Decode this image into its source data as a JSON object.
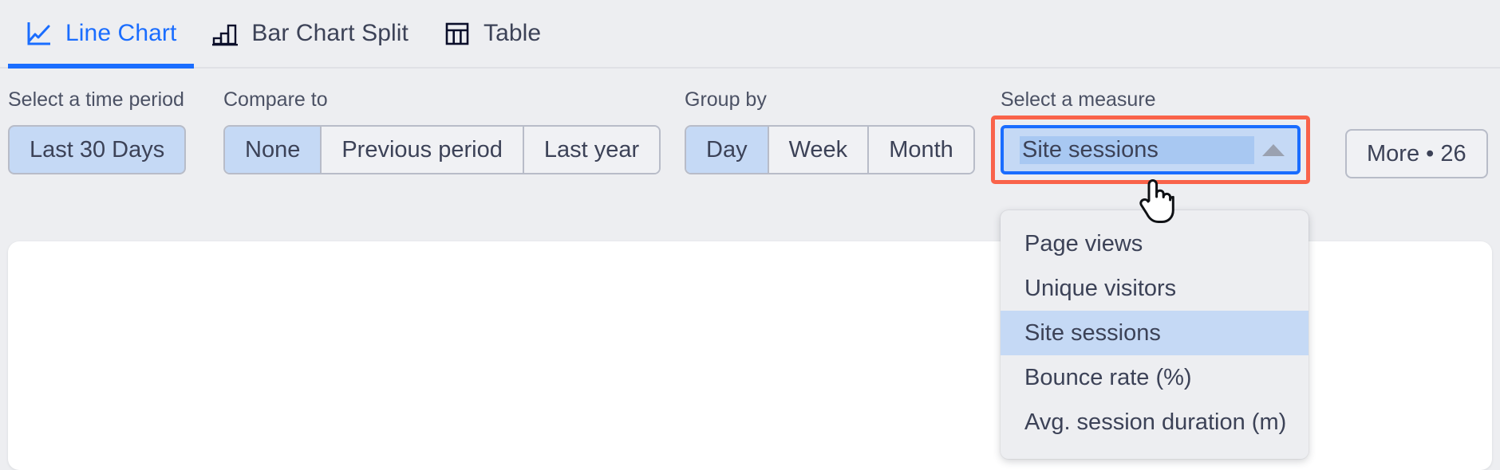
{
  "tabs": [
    {
      "label": "Line Chart",
      "icon": "line-chart-icon",
      "active": true
    },
    {
      "label": "Bar Chart Split",
      "icon": "bar-chart-icon",
      "active": false
    },
    {
      "label": "Table",
      "icon": "table-icon",
      "active": false
    }
  ],
  "filters": {
    "time_period": {
      "label": "Select a time period",
      "value": "Last 30 Days"
    },
    "compare_to": {
      "label": "Compare to",
      "options": [
        "None",
        "Previous period",
        "Last year"
      ],
      "selected": "None"
    },
    "group_by": {
      "label": "Group by",
      "options": [
        "Day",
        "Week",
        "Month"
      ],
      "selected": "Day"
    },
    "measure": {
      "label": "Select a measure",
      "value": "Site sessions",
      "expanded": true,
      "caret_icon": "caret-up-icon",
      "options": [
        "Page views",
        "Unique visitors",
        "Site sessions",
        "Bounce rate (%)",
        "Avg. session duration (m)"
      ],
      "selected_option": "Site sessions"
    },
    "more_button": {
      "label": "More • 26"
    }
  },
  "annotation": {
    "target": "measure-select",
    "color": "#f9634a"
  },
  "cursor": {
    "icon": "pointing-hand-cursor"
  },
  "colors": {
    "page_background": "#edeef1",
    "accent_blue": "#1a6dff",
    "selected_fill": "#c5d9f5",
    "text_primary": "#3c4257",
    "border_gray": "#b8bcc8",
    "annotation_red": "#f9634a",
    "card_white": "#ffffff"
  }
}
